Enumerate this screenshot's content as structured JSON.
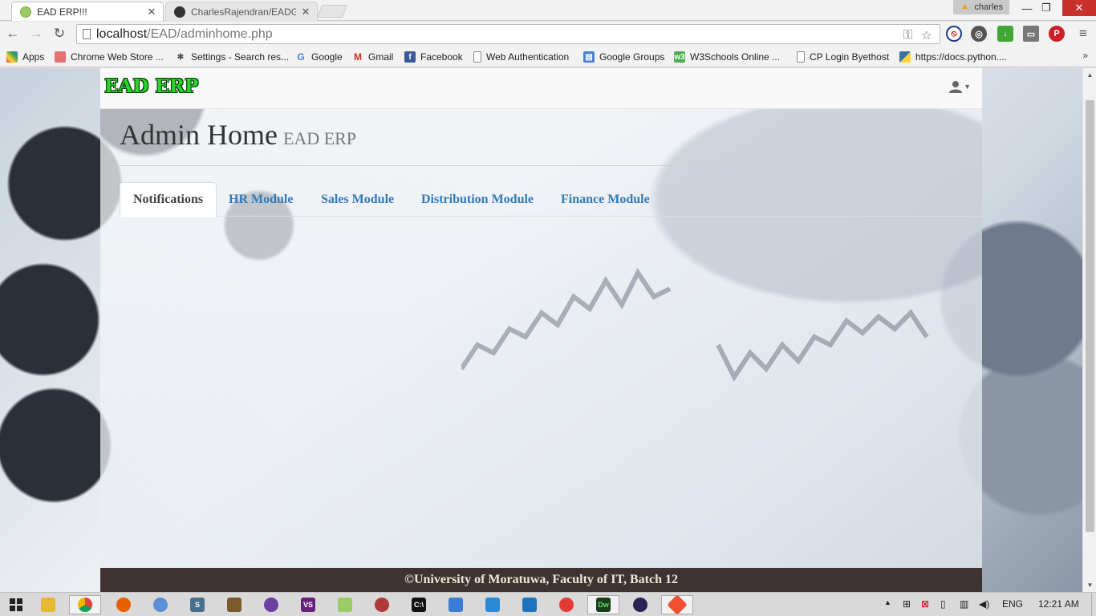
{
  "browser": {
    "tabs": [
      {
        "title": "EAD ERP!!!",
        "icon": "page-favicon",
        "active": true
      },
      {
        "title": "CharlesRajendran/EADGro",
        "icon": "github-icon",
        "active": false
      }
    ],
    "user_badge": "charles",
    "address": {
      "host": "localhost",
      "path": "/EAD/adminhome.php"
    },
    "bookmarks": [
      {
        "label": "Apps",
        "icon": "apps-grid-icon"
      },
      {
        "label": "Chrome Web Store ...",
        "icon": "webstore-icon"
      },
      {
        "label": "Settings - Search res...",
        "icon": "gear-icon"
      },
      {
        "label": "Google",
        "icon": "google-icon"
      },
      {
        "label": "Gmail",
        "icon": "gmail-icon"
      },
      {
        "label": "Facebook",
        "icon": "facebook-icon"
      },
      {
        "label": "Web Authentication",
        "icon": "page-icon"
      },
      {
        "label": "Google Groups",
        "icon": "groups-icon"
      },
      {
        "label": "W3Schools Online ...",
        "icon": "w3schools-icon"
      },
      {
        "label": "CP Login Byethost",
        "icon": "page-icon"
      },
      {
        "label": "https://docs.python....",
        "icon": "python-icon"
      }
    ],
    "bookmarks_more": "»"
  },
  "site": {
    "brand": "EAD ERP",
    "page_title": "Admin Home",
    "page_subtitle": "EAD ERP",
    "nav_tabs": [
      {
        "label": "Notifications",
        "active": true
      },
      {
        "label": "HR Module",
        "active": false
      },
      {
        "label": "Sales Module",
        "active": false
      },
      {
        "label": "Distribution Module",
        "active": false
      },
      {
        "label": "Finance Module",
        "active": false
      }
    ],
    "footer": "©University of Moratuwa, Faculty of IT, Batch 12"
  },
  "taskbar": {
    "language": "ENG",
    "clock": "12:21 AM"
  },
  "colors": {
    "brand_green": "#2ad42a",
    "link_blue": "#337ab7",
    "footer_bg": "#3f3232",
    "close_red": "#c8312b"
  }
}
